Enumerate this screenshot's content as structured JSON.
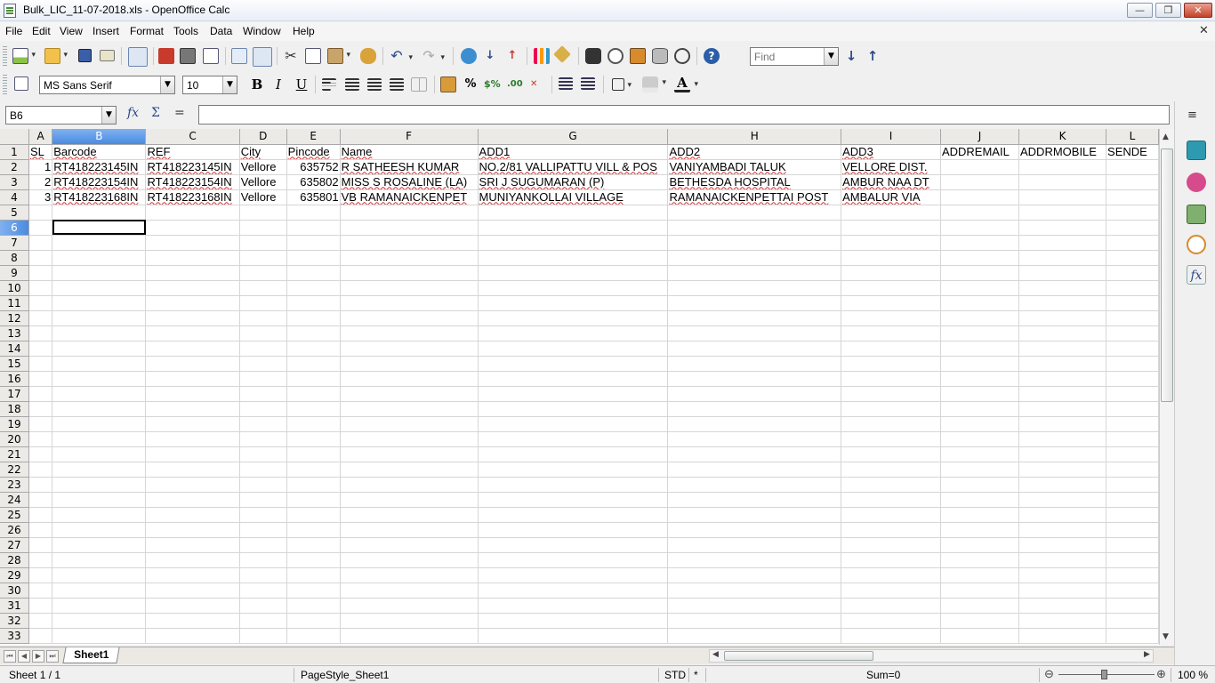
{
  "window": {
    "title": "Bulk_LIC_11-07-2018.xls - OpenOffice Calc",
    "min": "—",
    "max": "❐",
    "close": "✕",
    "doc_close": "✕"
  },
  "menu": [
    "File",
    "Edit",
    "View",
    "Insert",
    "Format",
    "Tools",
    "Data",
    "Window",
    "Help"
  ],
  "toolbar": {
    "find_placeholder": "Find",
    "font_name": "MS Sans Serif",
    "font_size": "10",
    "bold": "B",
    "italic": "I",
    "underline": "U",
    "percent": "%"
  },
  "formula_bar": {
    "cell_ref": "B6",
    "fx": "fx",
    "sum": "Σ",
    "equals": "=",
    "content": ""
  },
  "sheet": {
    "columns": [
      "A",
      "B",
      "C",
      "D",
      "E",
      "F",
      "G",
      "H",
      "I",
      "J",
      "K",
      "L"
    ],
    "selected_column": "B",
    "selected_row": 6,
    "rows": [
      [
        "SL",
        "Barcode",
        "REF",
        "City",
        "Pincode",
        "Name",
        "ADD1",
        "ADD2",
        "ADD3",
        "ADDREMAIL",
        "ADDRMOBILE",
        "SENDE"
      ],
      [
        "1",
        "RT418223145IN",
        "RT418223145IN",
        "Vellore",
        "635752",
        "R SATHEESH KUMAR",
        "NO.2/81 VALLIPATTU VILL & POS",
        "VANIYAMBADI TALUK",
        "VELLORE DIST.",
        "",
        "",
        ""
      ],
      [
        "2",
        "RT418223154IN",
        "RT418223154IN",
        "Vellore",
        "635802",
        "MISS S ROSALINE (LA)",
        "SRI J SUGUMARAN (P)",
        "BETHESDA HOSPITAL",
        "AMBUR NAA DT",
        "",
        "",
        ""
      ],
      [
        "3",
        "RT418223168IN",
        "RT418223168IN",
        "Vellore",
        "635801",
        "VB RAMANAICKENPET",
        "MUNIYANKOLLAI VILLAGE",
        "RAMANAICKENPETTAI POST",
        "AMBALUR VIA",
        "",
        "",
        ""
      ]
    ],
    "total_rows": 33
  },
  "tabs": {
    "sheet_name": "Sheet1"
  },
  "status": {
    "sheet": "Sheet 1 / 1",
    "page_style": "PageStyle_Sheet1",
    "mode": "STD",
    "modified": "*",
    "sum": "Sum=0",
    "zoom": "100 %"
  },
  "colors": {
    "selection": "#4b8be0",
    "spell_error": "#d03030",
    "title_gradient_end": "#e8eef7"
  }
}
